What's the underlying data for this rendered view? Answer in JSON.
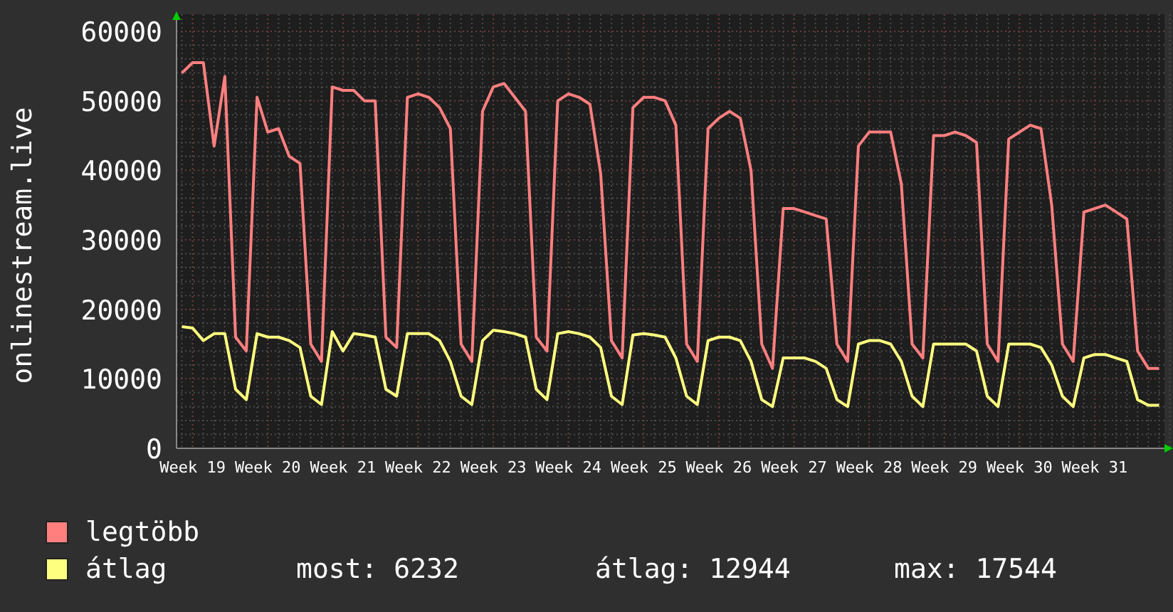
{
  "chart": {
    "chart_data": {
      "type": "line",
      "grid": true,
      "ylabel": "onlinestream.live",
      "ylim": [
        0,
        60000
      ],
      "yticks": [
        0,
        10000,
        20000,
        30000,
        40000,
        50000,
        60000
      ],
      "categories": [
        null,
        "Week 19",
        null,
        null,
        null,
        null,
        null,
        null,
        "Week 20",
        null,
        null,
        null,
        null,
        null,
        null,
        "Week 21",
        null,
        null,
        null,
        null,
        null,
        null,
        "Week 22",
        null,
        null,
        null,
        null,
        null,
        null,
        "Week 23",
        null,
        null,
        null,
        null,
        null,
        null,
        "Week 24",
        null,
        null,
        null,
        null,
        null,
        null,
        "Week 25",
        null,
        null,
        null,
        null,
        null,
        null,
        "Week 26",
        null,
        null,
        null,
        null,
        null,
        null,
        "Week 27",
        null,
        null,
        null,
        null,
        null,
        null,
        "Week 28",
        null,
        null,
        null,
        null,
        null,
        null,
        "Week 29",
        null,
        null,
        null,
        null,
        null,
        null,
        "Week 30",
        null,
        null,
        null,
        null,
        null,
        null,
        "Week 31",
        null,
        null,
        null,
        null,
        null,
        null
      ],
      "series": [
        {
          "name": "legtöbb",
          "color": "#ff7f7f",
          "values": [
            54000,
            55500,
            55500,
            43500,
            53500,
            16000,
            14000,
            50500,
            45500,
            46000,
            42000,
            41000,
            15000,
            12500,
            52000,
            51500,
            51500,
            50000,
            50000,
            16000,
            14500,
            50500,
            51000,
            50500,
            49000,
            46000,
            15000,
            12500,
            48500,
            52000,
            52500,
            50500,
            48500,
            16000,
            14000,
            50000,
            51000,
            50500,
            49500,
            39500,
            15500,
            13000,
            49000,
            50500,
            50500,
            50000,
            46500,
            15000,
            12500,
            46000,
            47500,
            48500,
            47500,
            40000,
            15000,
            11500,
            34500,
            34500,
            34000,
            33500,
            33000,
            15000,
            12500,
            43500,
            45500,
            45500,
            45500,
            38000,
            15000,
            13000,
            45000,
            45000,
            45500,
            45000,
            44000,
            15000,
            12500,
            44500,
            45500,
            46500,
            46000,
            35000,
            15000,
            12500,
            34000,
            34500,
            35000,
            34000,
            33000,
            14000,
            11500,
            11500
          ]
        },
        {
          "name": "átlag",
          "color": "#ffff7f",
          "values": [
            17500,
            17300,
            15500,
            16500,
            16500,
            8500,
            7000,
            16500,
            16000,
            16000,
            15500,
            14500,
            7500,
            6300,
            16800,
            14000,
            16500,
            16300,
            16000,
            8500,
            7500,
            16500,
            16500,
            16500,
            15500,
            12500,
            7500,
            6300,
            15500,
            17000,
            16800,
            16500,
            16000,
            8500,
            7000,
            16500,
            16800,
            16500,
            16000,
            14500,
            7500,
            6300,
            16300,
            16500,
            16300,
            16000,
            13000,
            7500,
            6300,
            15500,
            16000,
            16000,
            15500,
            12500,
            7000,
            6000,
            13000,
            13000,
            13000,
            12500,
            11500,
            7000,
            6000,
            15000,
            15500,
            15500,
            15000,
            12500,
            7500,
            6000,
            15000,
            15000,
            15000,
            15000,
            14000,
            7500,
            6000,
            15000,
            15000,
            15000,
            14500,
            12000,
            7500,
            6000,
            13000,
            13500,
            13500,
            13000,
            12500,
            7000,
            6200,
            6200
          ]
        }
      ]
    }
  },
  "legend": {
    "stats": [
      "most: 6232",
      "átlag: 12944",
      "max: 17544"
    ]
  }
}
